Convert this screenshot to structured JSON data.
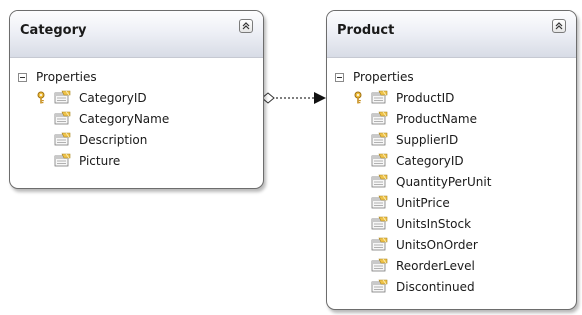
{
  "entities": {
    "category": {
      "title": "Category",
      "section": "Properties",
      "properties": [
        "CategoryID",
        "CategoryName",
        "Description",
        "Picture"
      ]
    },
    "product": {
      "title": "Product",
      "section": "Properties",
      "properties": [
        "ProductID",
        "ProductName",
        "SupplierID",
        "CategoryID",
        "QuantityPerUnit",
        "UnitPrice",
        "UnitsInStock",
        "UnitsOnOrder",
        "ReorderLevel",
        "Discontinued"
      ]
    }
  },
  "icons": {
    "collapse": "double-chevron-up-icon",
    "section_toggle": "collapse-minus-icon",
    "key": "key-icon",
    "property": "property-icon"
  },
  "colors": {
    "border": "#6d6d6d",
    "header_top": "#fdfdfe",
    "header_bottom": "#d8dce6",
    "key": "#e8b23a",
    "property_icon": "#e6b94a"
  }
}
